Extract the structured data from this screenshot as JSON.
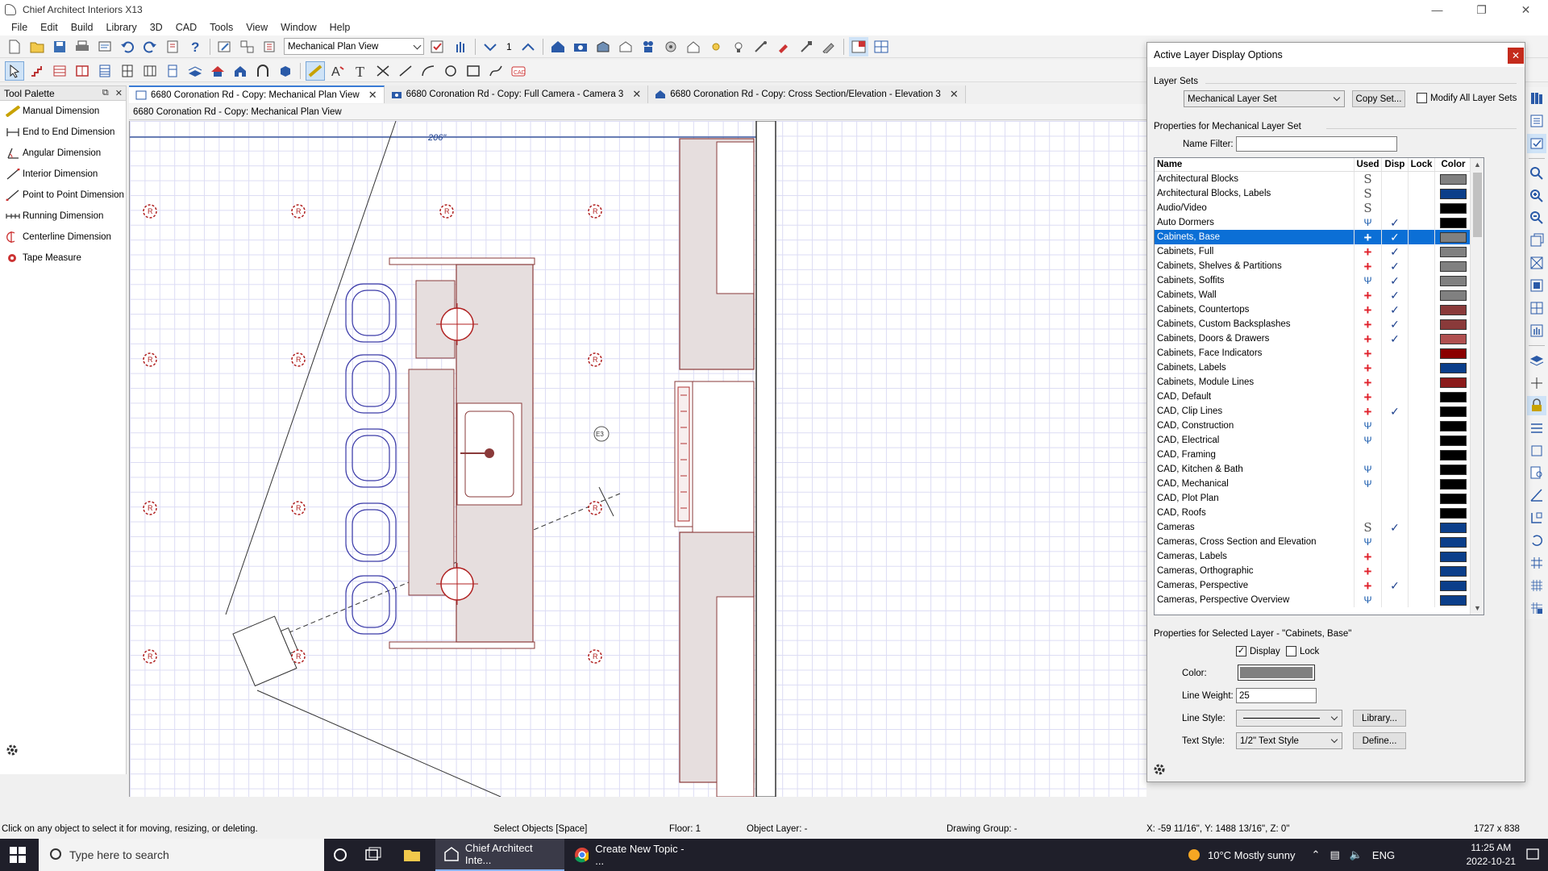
{
  "window": {
    "title": "Chief Architect Interiors X13"
  },
  "menu": [
    "File",
    "Edit",
    "Build",
    "Library",
    "3D",
    "CAD",
    "Tools",
    "View",
    "Window",
    "Help"
  ],
  "toolbar": {
    "view_select": "Mechanical Plan View",
    "floor_number": "1"
  },
  "tool_palette": {
    "title": "Tool Palette",
    "items": [
      "Manual Dimension",
      "End to End Dimension",
      "Angular Dimension",
      "Interior Dimension",
      "Point to Point Dimension",
      "Running Dimension",
      "Centerline Dimension",
      "Tape Measure"
    ]
  },
  "tabs": [
    {
      "label": "6680 Coronation Rd - Copy: Mechanical Plan View"
    },
    {
      "label": "6680 Coronation Rd - Copy: Full Camera - Camera 3"
    },
    {
      "label": "6680 Coronation Rd - Copy: Cross Section/Elevation - Elevation 3"
    }
  ],
  "view_title": "6680 Coronation Rd - Copy: Mechanical Plan View",
  "drawing": {
    "dimension_label": "206\"",
    "camera_tag": "E3"
  },
  "dialog": {
    "title": "Active Layer Display Options",
    "layer_sets_label": "Layer Sets",
    "layer_set_value": "Mechanical Layer Set",
    "copy_set_button": "Copy Set...",
    "modify_all_label": "Modify All Layer Sets",
    "properties_label": "Properties for Mechanical Layer Set",
    "name_filter_label": "Name Filter:",
    "name_filter_value": "",
    "columns": {
      "name": "Name",
      "used": "Used",
      "disp": "Disp",
      "lock": "Lock",
      "color": "Color"
    },
    "layers": [
      {
        "name": "Architectural Blocks",
        "used": "S",
        "disp": false,
        "color": "#808080"
      },
      {
        "name": "Architectural Blocks, Labels",
        "used": "S",
        "disp": false,
        "color": "#0b3e8a"
      },
      {
        "name": "Audio/Video",
        "used": "S",
        "disp": false,
        "color": "#000000"
      },
      {
        "name": "Auto Dormers",
        "used": "hand",
        "disp": true,
        "color": "#000000"
      },
      {
        "name": "Cabinets,  Base",
        "used": "plus",
        "disp": true,
        "color": "#808080",
        "selected": true
      },
      {
        "name": "Cabinets,  Full",
        "used": "plus",
        "disp": true,
        "color": "#808080"
      },
      {
        "name": "Cabinets,  Shelves & Partitions",
        "used": "plus",
        "disp": true,
        "color": "#808080"
      },
      {
        "name": "Cabinets,  Soffits",
        "used": "hand",
        "disp": true,
        "color": "#808080"
      },
      {
        "name": "Cabinets,  Wall",
        "used": "plus",
        "disp": true,
        "color": "#808080"
      },
      {
        "name": "Cabinets, Countertops",
        "used": "plus",
        "disp": true,
        "color": "#8a3a3a"
      },
      {
        "name": "Cabinets, Custom Backsplashes",
        "used": "plus",
        "disp": true,
        "color": "#8a3a3a"
      },
      {
        "name": "Cabinets, Doors & Drawers",
        "used": "plus",
        "disp": true,
        "color": "#b05050"
      },
      {
        "name": "Cabinets, Face Indicators",
        "used": "plus",
        "disp": false,
        "color": "#8b0000"
      },
      {
        "name": "Cabinets, Labels",
        "used": "plus",
        "disp": false,
        "color": "#0b3e8a"
      },
      {
        "name": "Cabinets, Module Lines",
        "used": "plus",
        "disp": false,
        "color": "#8b1a1a"
      },
      {
        "name": "CAD,  Default",
        "used": "plus",
        "disp": false,
        "color": "#000000"
      },
      {
        "name": "CAD, Clip Lines",
        "used": "plus",
        "disp": true,
        "color": "#000000"
      },
      {
        "name": "CAD, Construction",
        "used": "hand",
        "disp": false,
        "color": "#000000"
      },
      {
        "name": "CAD, Electrical",
        "used": "hand",
        "disp": false,
        "color": "#000000"
      },
      {
        "name": "CAD, Framing",
        "used": "",
        "disp": false,
        "color": "#000000"
      },
      {
        "name": "CAD, Kitchen & Bath",
        "used": "hand",
        "disp": false,
        "color": "#000000"
      },
      {
        "name": "CAD, Mechanical",
        "used": "hand",
        "disp": false,
        "color": "#000000"
      },
      {
        "name": "CAD, Plot Plan",
        "used": "",
        "disp": false,
        "color": "#000000"
      },
      {
        "name": "CAD, Roofs",
        "used": "",
        "disp": false,
        "color": "#000000"
      },
      {
        "name": "Cameras",
        "used": "S",
        "disp": true,
        "color": "#0b3e8a"
      },
      {
        "name": "Cameras, Cross Section and Elevation",
        "used": "hand",
        "disp": false,
        "color": "#0b3e8a"
      },
      {
        "name": "Cameras, Labels",
        "used": "plus",
        "disp": false,
        "color": "#0b3e8a"
      },
      {
        "name": "Cameras, Orthographic",
        "used": "plus",
        "disp": false,
        "color": "#0b3e8a"
      },
      {
        "name": "Cameras, Perspective",
        "used": "plus",
        "disp": true,
        "color": "#0b3e8a"
      },
      {
        "name": "Cameras, Perspective Overview",
        "used": "hand",
        "disp": false,
        "color": "#0b3e8a"
      }
    ],
    "selected_props_label": "Properties for Selected Layer - \"Cabinets,  Base\"",
    "display_label": "Display",
    "lock_label": "Lock",
    "color_label": "Color:",
    "color_value": "#808080",
    "line_weight_label": "Line Weight:",
    "line_weight_value": "25",
    "line_style_label": "Line Style:",
    "library_button": "Library...",
    "text_style_label": "Text Style:",
    "text_style_value": "1/2\" Text Style",
    "define_button": "Define..."
  },
  "status": {
    "hint": "Click on any object to select it for moving, resizing, or deleting.",
    "mode": "Select Objects [Space]",
    "floor": "Floor: 1",
    "object_layer": "Object Layer: -",
    "drawing_group": "Drawing Group: -",
    "coords": "X: -59 11/16\", Y: 1488 13/16\", Z: 0\"",
    "size": "1727 x 838"
  },
  "taskbar": {
    "search_placeholder": "Type here to search",
    "apps": [
      "Chief Architect Inte...",
      "Create New Topic - ..."
    ],
    "weather": "10°C  Mostly sunny",
    "lang": "ENG",
    "time": "11:25 AM",
    "date": "2022-10-21"
  }
}
